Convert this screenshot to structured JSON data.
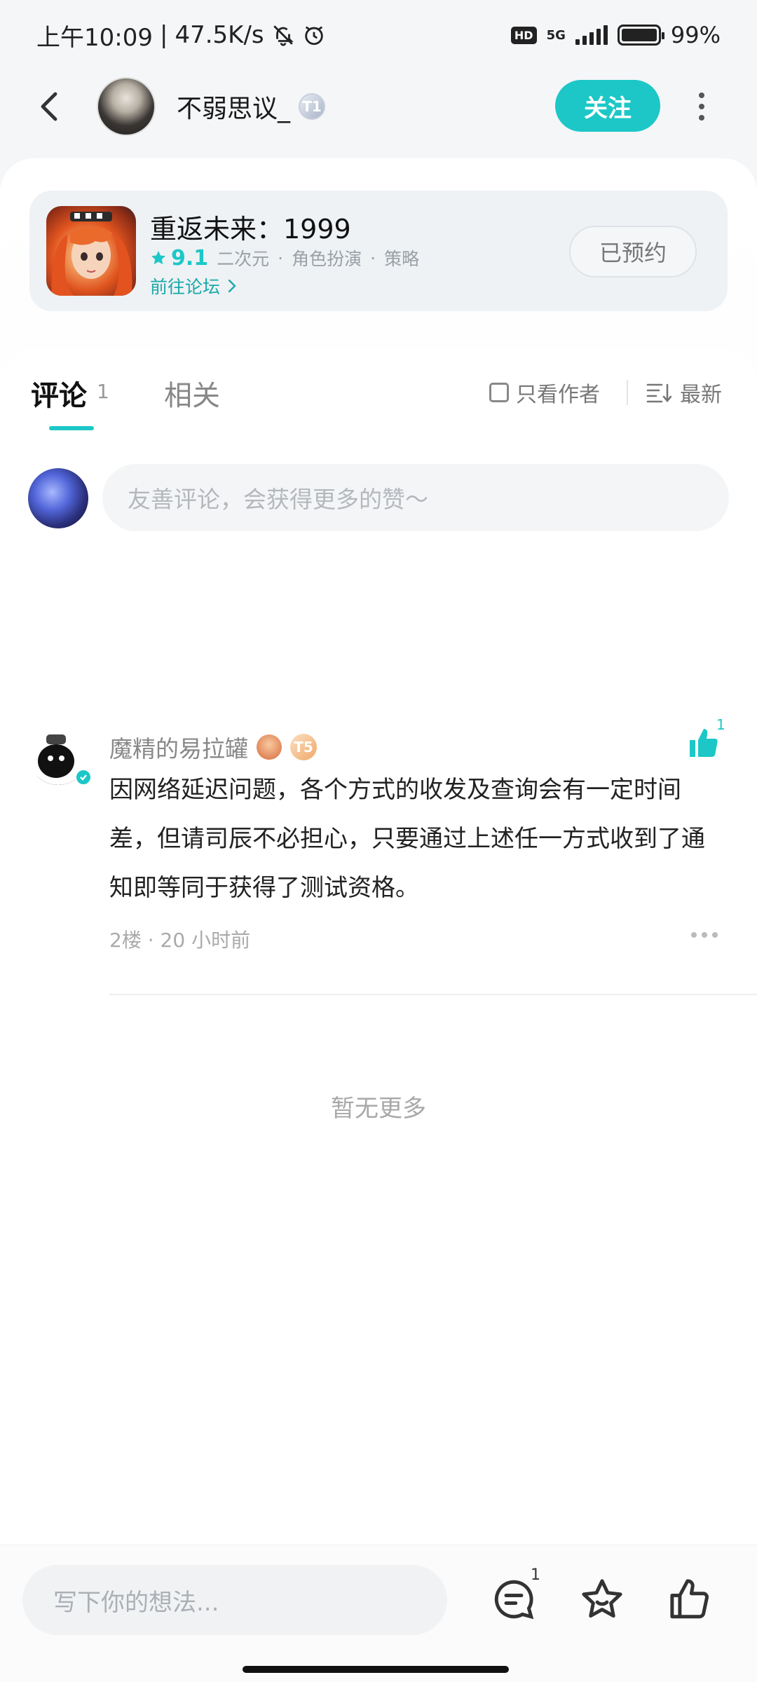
{
  "status_bar": {
    "time": "上午10:09",
    "net_speed": "47.5K/s",
    "hd_label": "HD",
    "network": "5G",
    "battery": "99%"
  },
  "header": {
    "username": "不弱思议_",
    "level": "T1",
    "follow_label": "关注"
  },
  "game_card": {
    "title": "重返未来：1999",
    "rating": "9.1",
    "tags": [
      "二次元",
      "角色扮演",
      "策略"
    ],
    "forum_link": "前往论坛",
    "reserve_label": "已预约"
  },
  "tabs": {
    "comments_label": "评论",
    "comments_count": "1",
    "related_label": "相关",
    "author_only_label": "只看作者",
    "sort_label": "最新"
  },
  "composer": {
    "placeholder": "友善评论，会获得更多的赞～"
  },
  "comment": {
    "author": "魔精的易拉罐",
    "level": "T5",
    "like_count": "1",
    "body": "因网络延迟问题，各个方式的收发及查询会有一定时间差，但请司辰不必担心，只要通过上述任一方式收到了通知即等同于获得了测试资格。",
    "floor": "2楼",
    "time": "20 小时前"
  },
  "no_more_label": "暂无更多",
  "bottom_bar": {
    "input_placeholder": "写下你的想法...",
    "comment_count": "1"
  },
  "colors": {
    "accent": "#1dc7c7",
    "text_primary": "#1a1a1a",
    "text_secondary": "#888888"
  }
}
